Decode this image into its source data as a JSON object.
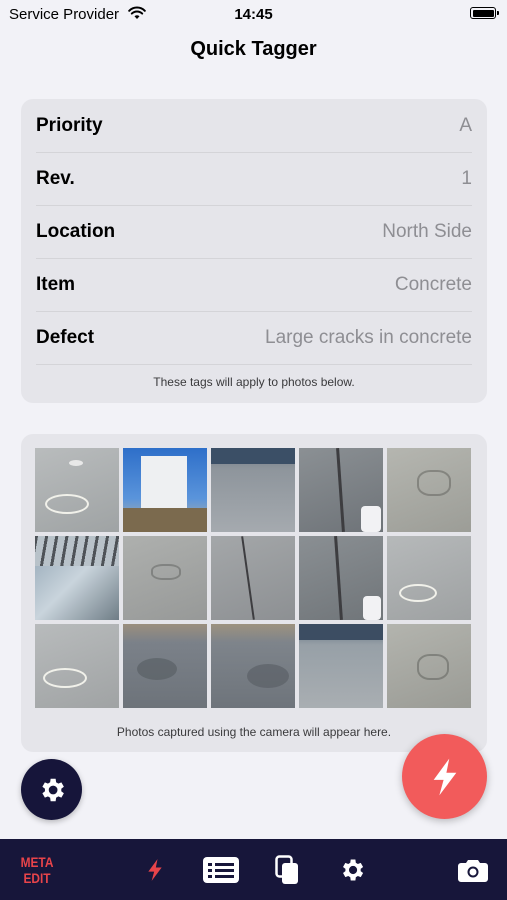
{
  "status_bar": {
    "carrier": "Service Provider",
    "time": "14:45",
    "wifi_icon": "wifi-icon",
    "battery_icon": "battery-icon"
  },
  "nav": {
    "title": "Quick Tagger"
  },
  "tags": {
    "rows": [
      {
        "key": "Priority",
        "value": "A"
      },
      {
        "key": "Rev.",
        "value": "1"
      },
      {
        "key": "Location",
        "value": "North Side"
      },
      {
        "key": "Item",
        "value": "Concrete"
      },
      {
        "key": "Defect",
        "value": "Large cracks in concrete"
      }
    ],
    "note": "These tags will apply to photos below."
  },
  "photos": {
    "note": "Photos captured using the camera will appear here.",
    "thumbnails": [
      {
        "subject": "concrete with chalk mark"
      },
      {
        "subject": "white wall and blue sky"
      },
      {
        "subject": "concrete courtyard"
      },
      {
        "subject": "cracked concrete with bucket"
      },
      {
        "subject": "concrete with chalk mark"
      },
      {
        "subject": "scaffolding and sky"
      },
      {
        "subject": "concrete surface"
      },
      {
        "subject": "concrete crack"
      },
      {
        "subject": "cracked concrete with bucket"
      },
      {
        "subject": "concrete with chalk mark"
      },
      {
        "subject": "concrete with chalk mark"
      },
      {
        "subject": "wet concrete yard"
      },
      {
        "subject": "wet concrete yard"
      },
      {
        "subject": "concrete courtyard"
      },
      {
        "subject": "concrete surface"
      }
    ]
  },
  "fab": {
    "settings_icon": "gear-icon",
    "flash_icon": "lightning-icon",
    "flash_color": "#f25b5b",
    "settings_color": "#16153a"
  },
  "tab_bar": {
    "meta_line1": "META",
    "meta_line2": "EDIT",
    "items": [
      "lightning-icon",
      "list-icon",
      "copy-icon",
      "gear-icon",
      "camera-icon"
    ],
    "background": "#17163a",
    "accent": "#e8444a"
  }
}
